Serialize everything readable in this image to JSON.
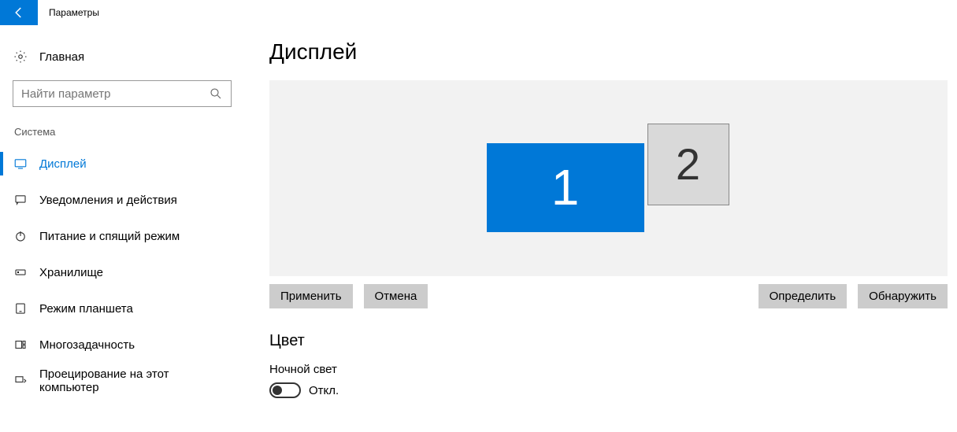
{
  "window": {
    "title": "Параметры"
  },
  "sidebar": {
    "home_label": "Главная",
    "search_placeholder": "Найти параметр",
    "category_label": "Система",
    "items": [
      {
        "label": "Дисплей",
        "icon": "display-icon",
        "active": true
      },
      {
        "label": "Уведомления и действия",
        "icon": "chat-icon"
      },
      {
        "label": "Питание и спящий режим",
        "icon": "power-icon"
      },
      {
        "label": "Хранилище",
        "icon": "storage-icon"
      },
      {
        "label": "Режим планшета",
        "icon": "tablet-icon"
      },
      {
        "label": "Многозадачность",
        "icon": "multitask-icon"
      },
      {
        "label": "Проецирование на этот компьютер",
        "icon": "project-icon"
      }
    ]
  },
  "main": {
    "heading": "Дисплей",
    "monitors": {
      "1": "1",
      "2": "2"
    },
    "buttons": {
      "apply": "Применить",
      "cancel": "Отмена",
      "identify": "Определить",
      "detect": "Обнаружить"
    },
    "color_section": "Цвет",
    "night_light_label": "Ночной свет",
    "night_light_state": "Откл."
  }
}
